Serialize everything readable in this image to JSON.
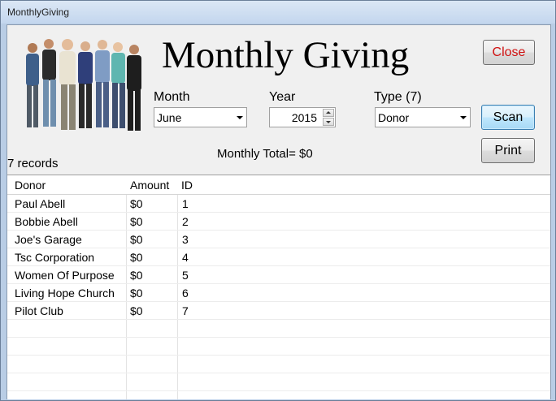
{
  "window": {
    "title": "MonthlyGiving"
  },
  "header": {
    "title": "Monthly Giving"
  },
  "buttons": {
    "close": "Close",
    "scan": "Scan",
    "print": "Print"
  },
  "filters": {
    "month_label": "Month",
    "month_value": "June",
    "year_label": "Year",
    "year_value": "2015",
    "type_label": "Type (7)",
    "type_value": "Donor"
  },
  "summary": {
    "total": "Monthly Total= $0",
    "records": "7 records"
  },
  "colors": {
    "close_text": "#d01010",
    "scan_border": "#3c7fb1"
  },
  "icons": {
    "people_image": "group-of-people-image"
  },
  "table": {
    "columns": [
      "Donor",
      "Amount",
      "ID"
    ],
    "rows": [
      {
        "donor": "Paul Abell",
        "amount": "$0",
        "id": "1"
      },
      {
        "donor": "Bobbie Abell",
        "amount": "$0",
        "id": "2"
      },
      {
        "donor": "Joe's Garage",
        "amount": "$0",
        "id": "3"
      },
      {
        "donor": "Tsc Corporation",
        "amount": "$0",
        "id": "4"
      },
      {
        "donor": "Women Of Purpose",
        "amount": "$0",
        "id": "5"
      },
      {
        "donor": "Living Hope Church",
        "amount": "$0",
        "id": "6"
      },
      {
        "donor": "Pilot Club",
        "amount": "$0",
        "id": "7"
      }
    ]
  }
}
